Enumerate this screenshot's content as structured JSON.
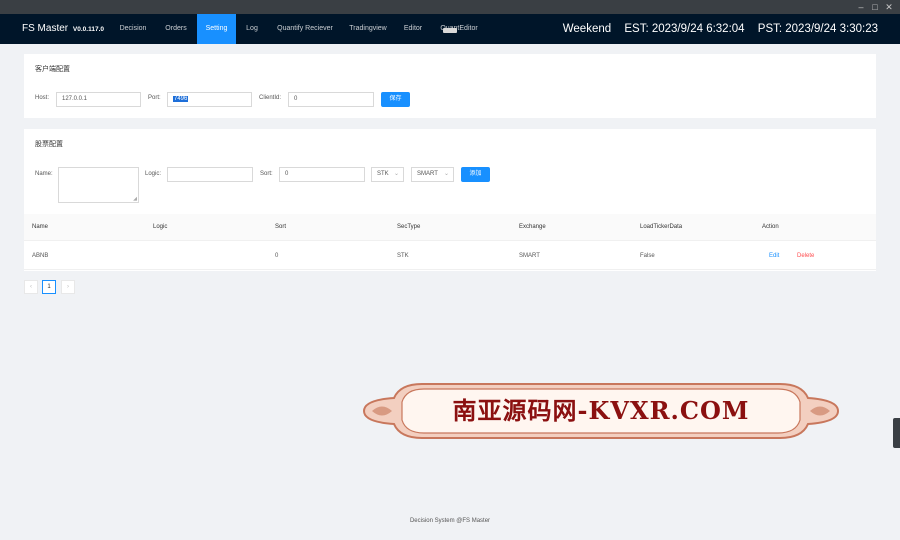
{
  "window_controls": [
    "–",
    "□",
    "✕"
  ],
  "app": {
    "name": "FS Master",
    "version": "V0.0.117.0"
  },
  "nav": [
    "Decision",
    "Orders",
    "Setting",
    "Log",
    "Quantify Reciever",
    "Tradingview",
    "Editor",
    "QuantEditor"
  ],
  "active_nav": "Setting",
  "status": {
    "day": "Weekend",
    "est": "EST: 2023/9/24 6:32:04",
    "pst": "PST: 2023/9/24 3:30:23"
  },
  "client_config": {
    "title": "客户端配置",
    "host_label": "Host:",
    "host_value": "127.0.0.1",
    "port_label": "Port:",
    "port_value": "7496",
    "clientid_label": "ClientId:",
    "clientid_value": "0",
    "save_label": "保存"
  },
  "stock_config": {
    "title": "股票配置",
    "name_label": "Name:",
    "logic_label": "Logic:",
    "sort_label": "Sort:",
    "sort_value": "0",
    "sectype_value": "STK",
    "exchange_value": "SMART",
    "add_label": "添加"
  },
  "table": {
    "headers": [
      "Name",
      "Logic",
      "Sort",
      "SecType",
      "Exchange",
      "LoadTickerData",
      "Action"
    ],
    "rows": [
      {
        "name": "ABNB",
        "logic": "",
        "sort": "0",
        "sectype": "STK",
        "exchange": "SMART",
        "load": "False",
        "edit": "Edit",
        "delete": "Delete"
      }
    ]
  },
  "pagination": {
    "prev": "‹",
    "page": "1",
    "next": "›"
  },
  "footer": "Decision System @FS Master",
  "watermark": "南亚源码网-KVXR.COM",
  "colors": {
    "header_bg": "#001529",
    "accent": "#1890ff",
    "delete": "#ff4d4f",
    "page_bg": "#f0f2f5"
  }
}
